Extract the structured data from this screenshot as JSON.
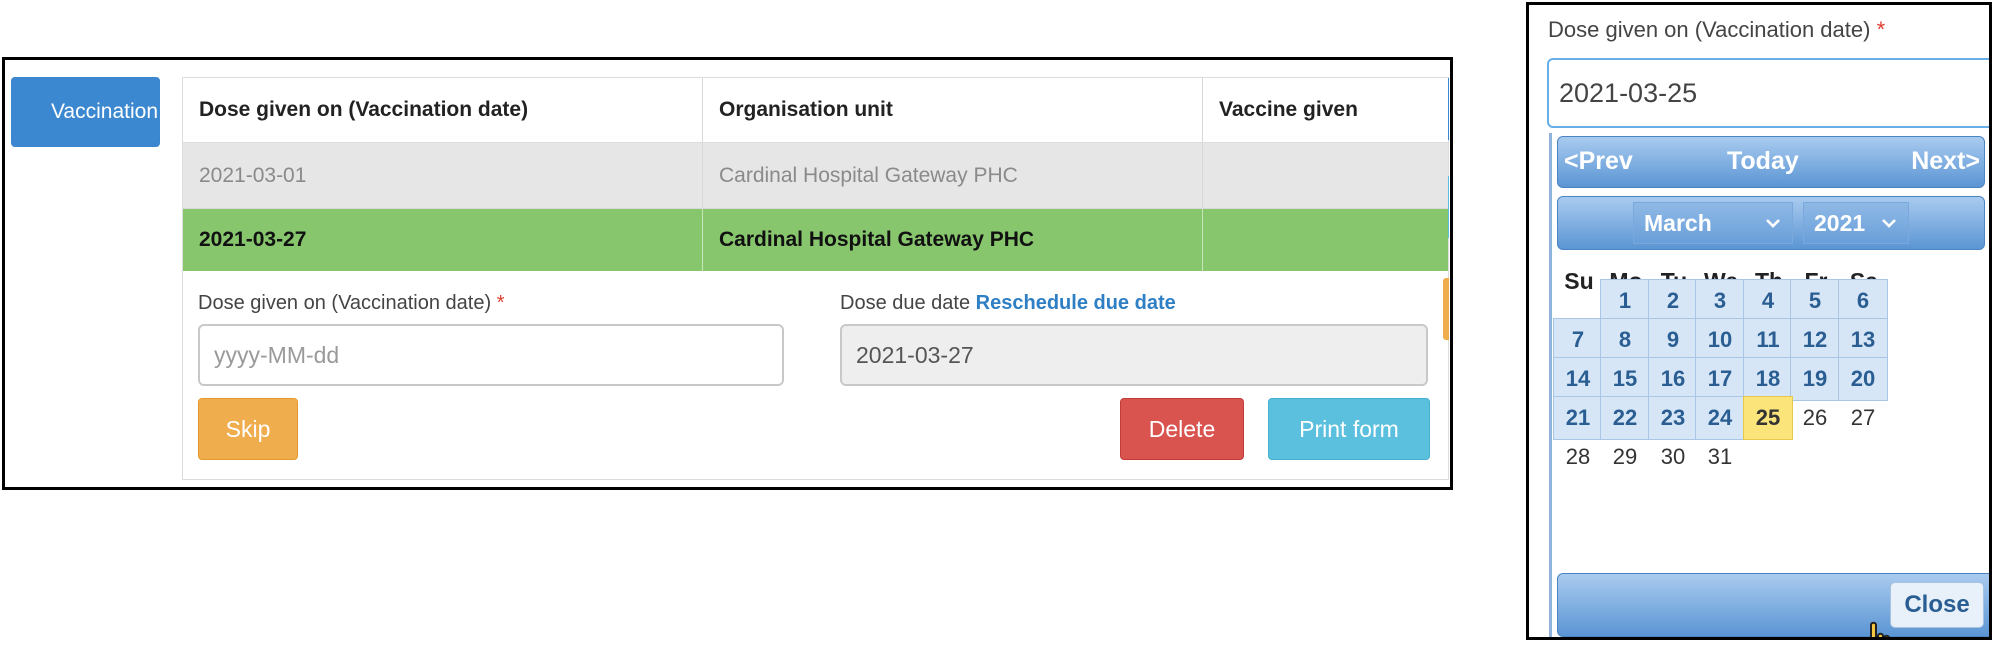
{
  "left": {
    "tab_label": "Vaccination",
    "table": {
      "headers": [
        "Dose given on (Vaccination date)",
        "Organisation unit",
        "Vaccine given"
      ],
      "rows": [
        [
          "2021-03-01",
          "Cardinal Hospital Gateway PHC",
          ""
        ],
        [
          "2021-03-27",
          "Cardinal Hospital Gateway PHC",
          ""
        ]
      ]
    },
    "form": {
      "dose_label": "Dose given on (Vaccination date)",
      "required_mark": "*",
      "dose_placeholder": "yyyy-MM-dd",
      "due_label": "Dose due date",
      "reschedule_link": "Reschedule due date",
      "due_value": "2021-03-27",
      "skip_label": "Skip",
      "delete_label": "Delete",
      "print_label": "Print form"
    },
    "colors": {
      "tab": "#3b88d1",
      "green_row": "#87c66d",
      "skip": "#f0ad4e",
      "delete": "#d9534f",
      "print": "#5bc0de"
    }
  },
  "right": {
    "label": "Dose given on (Vaccination date)",
    "required_mark": "*",
    "input_value": "2021-03-25",
    "datepicker": {
      "prev": "<Prev",
      "today": "Today",
      "next": "Next>",
      "month": "March",
      "year": "2021",
      "weekdays": [
        "Su",
        "Mo",
        "Tu",
        "We",
        "Th",
        "Fr",
        "Sa"
      ],
      "weeks": [
        [
          "",
          "1",
          "2",
          "3",
          "4",
          "5",
          "6"
        ],
        [
          "7",
          "8",
          "9",
          "10",
          "11",
          "12",
          "13"
        ],
        [
          "14",
          "15",
          "16",
          "17",
          "18",
          "19",
          "20"
        ],
        [
          "21",
          "22",
          "23",
          "24",
          "25",
          "26",
          "27"
        ],
        [
          "28",
          "29",
          "30",
          "31",
          "",
          "",
          ""
        ]
      ],
      "selected_day": "25",
      "close": "Close"
    },
    "icons": {
      "chevron": "chevron-down-icon",
      "pointer": "hand-pointer-icon"
    }
  }
}
